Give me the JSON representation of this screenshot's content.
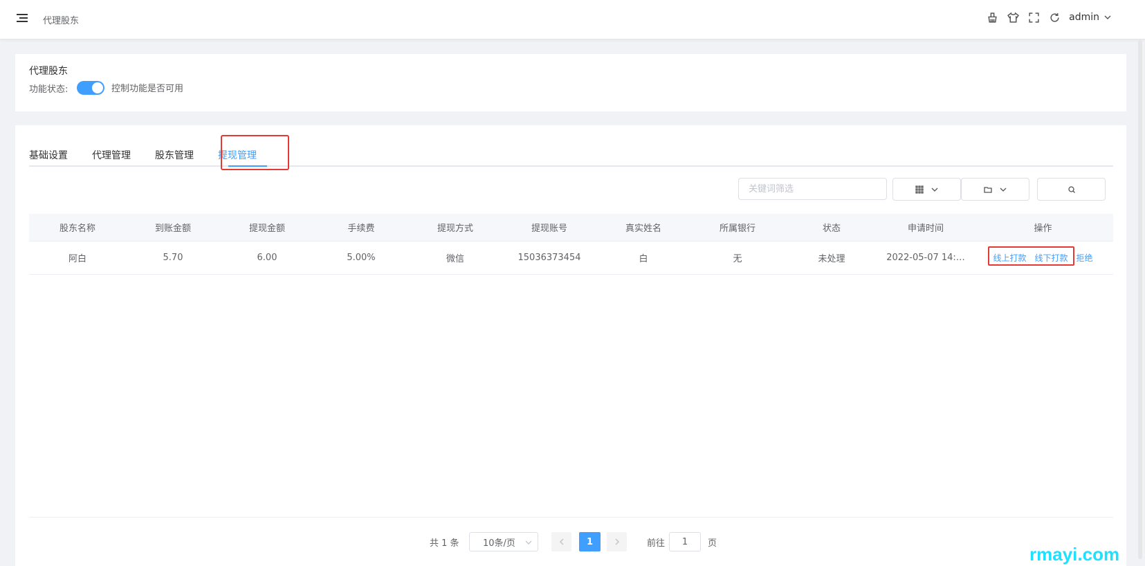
{
  "header": {
    "breadcrumb": "代理股东",
    "icons": [
      "clear-icon",
      "theme-icon",
      "fullscreen-icon",
      "refresh-icon"
    ],
    "user": "admin"
  },
  "module": {
    "title": "代理股东",
    "status_label": "功能状态:",
    "switch_on": true,
    "switch_desc": "控制功能是否可用"
  },
  "tabs": [
    {
      "label": "基础设置",
      "active": false
    },
    {
      "label": "代理管理",
      "active": false
    },
    {
      "label": "股东管理",
      "active": false
    },
    {
      "label": "提现管理",
      "active": true
    }
  ],
  "toolbar": {
    "search_placeholder": "关键词筛选"
  },
  "table": {
    "columns": [
      "股东名称",
      "到账金额",
      "提现金额",
      "手续费",
      "提现方式",
      "提现账号",
      "真实姓名",
      "所属银行",
      "状态",
      "申请时间",
      "操作"
    ],
    "rows": [
      {
        "name": "阿白",
        "received": "5.70",
        "amount": "6.00",
        "fee": "5.00%",
        "method": "微信",
        "account": "15036373454",
        "real_name": "白",
        "bank": "无",
        "status": "未处理",
        "time": "2022-05-07 14:…",
        "actions": [
          "线上打款",
          "线下打款",
          "拒绝"
        ]
      }
    ]
  },
  "pagination": {
    "total": "共 1 条",
    "page_size": "10条/页",
    "current": "1",
    "goto_label": "前往",
    "goto_value": "1",
    "page_suffix": "页"
  },
  "watermark": "rmayi.com",
  "colors": {
    "primary": "#409eff",
    "highlight_box": "#e53935",
    "watermark": "#1ee0ff"
  }
}
